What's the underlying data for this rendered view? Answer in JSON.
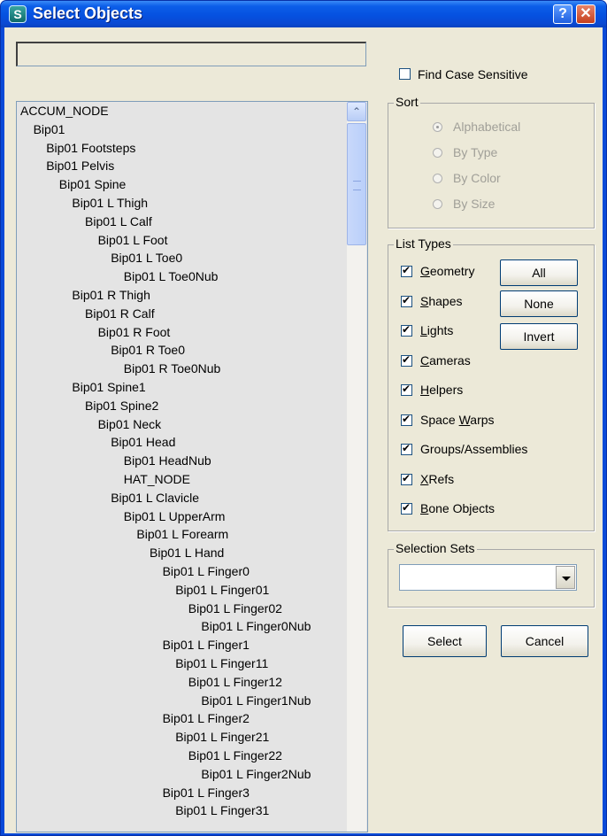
{
  "window": {
    "title": "Select Objects",
    "help": "?",
    "close": "✕",
    "app_icon": "S"
  },
  "filter": {
    "value": ""
  },
  "tree": [
    {
      "label": "ACCUM_NODE",
      "depth": 0
    },
    {
      "label": "Bip01",
      "depth": 1
    },
    {
      "label": "Bip01 Footsteps",
      "depth": 2
    },
    {
      "label": "Bip01 Pelvis",
      "depth": 2
    },
    {
      "label": "Bip01 Spine",
      "depth": 3
    },
    {
      "label": "Bip01 L Thigh",
      "depth": 4
    },
    {
      "label": "Bip01 L Calf",
      "depth": 5
    },
    {
      "label": "Bip01 L Foot",
      "depth": 6
    },
    {
      "label": "Bip01 L Toe0",
      "depth": 7
    },
    {
      "label": "Bip01 L Toe0Nub",
      "depth": 8
    },
    {
      "label": "Bip01 R Thigh",
      "depth": 4
    },
    {
      "label": "Bip01 R Calf",
      "depth": 5
    },
    {
      "label": "Bip01 R Foot",
      "depth": 6
    },
    {
      "label": "Bip01 R Toe0",
      "depth": 7
    },
    {
      "label": "Bip01 R Toe0Nub",
      "depth": 8
    },
    {
      "label": "Bip01 Spine1",
      "depth": 4
    },
    {
      "label": "Bip01 Spine2",
      "depth": 5
    },
    {
      "label": "Bip01 Neck",
      "depth": 6
    },
    {
      "label": "Bip01 Head",
      "depth": 7
    },
    {
      "label": "Bip01 HeadNub",
      "depth": 8
    },
    {
      "label": "HAT_NODE",
      "depth": 8
    },
    {
      "label": "Bip01 L Clavicle",
      "depth": 7
    },
    {
      "label": "Bip01 L UpperArm",
      "depth": 8
    },
    {
      "label": "Bip01 L Forearm",
      "depth": 9
    },
    {
      "label": "Bip01 L Hand",
      "depth": 10
    },
    {
      "label": "Bip01 L Finger0",
      "depth": 11
    },
    {
      "label": "Bip01 L Finger01",
      "depth": 12
    },
    {
      "label": "Bip01 L Finger02",
      "depth": 13
    },
    {
      "label": "Bip01 L Finger0Nub",
      "depth": 14
    },
    {
      "label": "Bip01 L Finger1",
      "depth": 11
    },
    {
      "label": "Bip01 L Finger11",
      "depth": 12
    },
    {
      "label": "Bip01 L Finger12",
      "depth": 13
    },
    {
      "label": "Bip01 L Finger1Nub",
      "depth": 14
    },
    {
      "label": "Bip01 L Finger2",
      "depth": 11
    },
    {
      "label": "Bip01 L Finger21",
      "depth": 12
    },
    {
      "label": "Bip01 L Finger22",
      "depth": 13
    },
    {
      "label": "Bip01 L Finger2Nub",
      "depth": 14
    },
    {
      "label": "Bip01 L Finger3",
      "depth": 11
    },
    {
      "label": "Bip01 L Finger31",
      "depth": 12
    }
  ],
  "options": {
    "find_case_sensitive": "Find Case Sensitive",
    "find_case_sensitive_checked": false
  },
  "sort": {
    "title": "Sort",
    "options": [
      "Alphabetical",
      "By Type",
      "By Color",
      "By Size"
    ],
    "selected": "Alphabetical"
  },
  "list_types": {
    "title": "List Types",
    "items": [
      {
        "pre": "",
        "u": "G",
        "post": "eometry",
        "checked": true
      },
      {
        "pre": "",
        "u": "S",
        "post": "hapes",
        "checked": true
      },
      {
        "pre": "",
        "u": "L",
        "post": "ights",
        "checked": true
      },
      {
        "pre": "",
        "u": "C",
        "post": "ameras",
        "checked": true
      },
      {
        "pre": "",
        "u": "H",
        "post": "elpers",
        "checked": true
      },
      {
        "pre": "Space ",
        "u": "W",
        "post": "arps",
        "checked": true
      },
      {
        "pre": "Groups/Assemblies",
        "u": "",
        "post": "",
        "checked": true
      },
      {
        "pre": "",
        "u": "X",
        "post": "Refs",
        "checked": true
      },
      {
        "pre": "",
        "u": "B",
        "post": "one Objects",
        "checked": true
      }
    ],
    "all": "All",
    "none": "None",
    "invert": "Invert"
  },
  "selection_sets": {
    "title": "Selection Sets",
    "value": ""
  },
  "actions": {
    "select": "Select",
    "cancel": "Cancel"
  },
  "colors": {
    "titlebar": "#0551e0",
    "face": "#ece9d8",
    "list_bg": "#e4e4e4"
  }
}
